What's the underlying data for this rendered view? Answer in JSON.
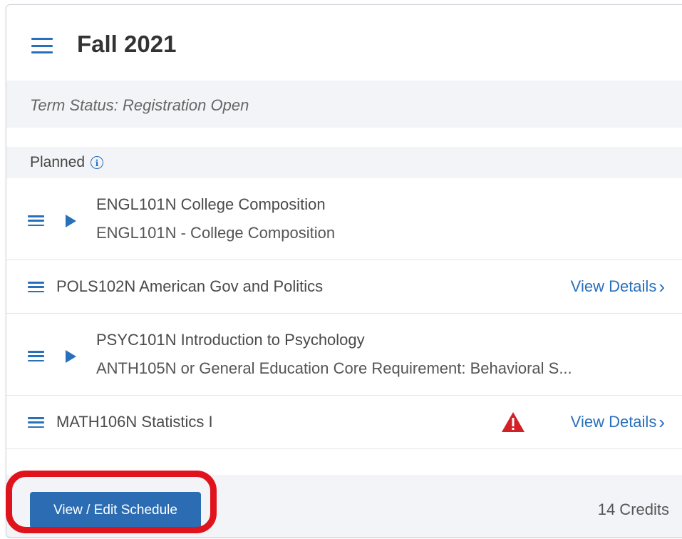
{
  "term": {
    "title": "Fall 2021",
    "status": "Term Status: Registration Open"
  },
  "section": {
    "label": "Planned",
    "info_icon": "info-icon"
  },
  "courses": [
    {
      "line1": "ENGL101N College Composition",
      "line2": "ENGL101N - College Composition",
      "expandable": true
    },
    {
      "line1": "POLS102N American Gov and Politics",
      "link": "View Details",
      "expandable": false
    },
    {
      "line1": "PSYC101N Introduction to Psychology",
      "line2": "ANTH105N or General Education Core Requirement: Behavioral S...",
      "expandable": true
    },
    {
      "line1": "MATH106N Statistics I",
      "link": "View Details",
      "warning": true,
      "expandable": false
    }
  ],
  "footer": {
    "button_label": "View / Edit Schedule",
    "credits": "14 Credits"
  },
  "colors": {
    "accent": "#2970bb",
    "button": "#2b6cb3",
    "warning": "#d32027",
    "annotation": "#e0131c"
  },
  "icons": {
    "header_menu": "hamburger-menu-icon",
    "row_drag": "drag-handle-icon",
    "expand": "play-triangle-icon",
    "warning": "warning-triangle-icon",
    "chevron": "chevron-right-icon"
  }
}
